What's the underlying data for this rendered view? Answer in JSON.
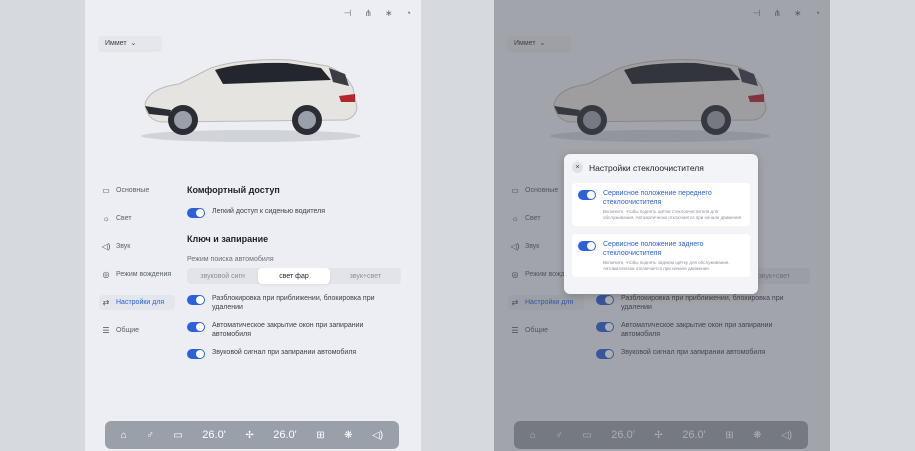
{
  "top_icons": [
    "⊣",
    "⋔",
    "∗",
    "◔"
  ],
  "profile": {
    "label": "Иммет"
  },
  "nav": [
    {
      "icon": "▭",
      "label": "Основные",
      "active": false
    },
    {
      "icon": "☼",
      "label": "Свет",
      "active": false
    },
    {
      "icon": "◁)",
      "label": "Звук",
      "active": false
    },
    {
      "icon": "◎",
      "label": "Режим вождения",
      "active": false
    },
    {
      "icon": "⇄",
      "label": "Настройки для",
      "active": true
    },
    {
      "icon": "☰",
      "label": "Общие",
      "active": false
    }
  ],
  "comfort": {
    "title": "Комфортный доступ",
    "option": "Легкий доступ к сиденью водителя"
  },
  "keys": {
    "title": "Ключ и запирание",
    "mode_label": "Режим поиска автомобиля",
    "modes": [
      "звуковой сигн",
      "свет фар",
      "звук+свет"
    ],
    "selected": 1,
    "options": [
      "Разблокировка при приближении, блокировка при удалении",
      "Автоматическое закрытие окон при запирании автомобиля",
      "Звуковой сигнал при запирании автомобиля"
    ]
  },
  "bottom_bar": {
    "home_icon": "⌂",
    "fan_seat_icon": "♂",
    "defrost_icon": "▭",
    "temp_left": "26.0'",
    "fan_icon": "✢",
    "temp_right": "26.0'",
    "grid_icon": "⊞",
    "climate_icon": "❋",
    "volume_icon": "◁)"
  },
  "dialog": {
    "title": "Настройки стеклоочистителя",
    "close_icon": "×",
    "cards": [
      {
        "title": "Сервисное положение переднего стеклоочистителя",
        "desc": "Включите, чтобы поднять щётки стеклоочистителя для обслуживания. Автоматически отключается при начале движения."
      },
      {
        "title": "Сервисное положение заднего стеклоочистителя",
        "desc": "Включите, чтобы поднять заднюю щётку для обслуживания. Автоматически отключается при начале движения."
      }
    ]
  },
  "colors": {
    "accent": "#2c62d8",
    "background": "#eceef3",
    "page": "#d6d9de"
  }
}
